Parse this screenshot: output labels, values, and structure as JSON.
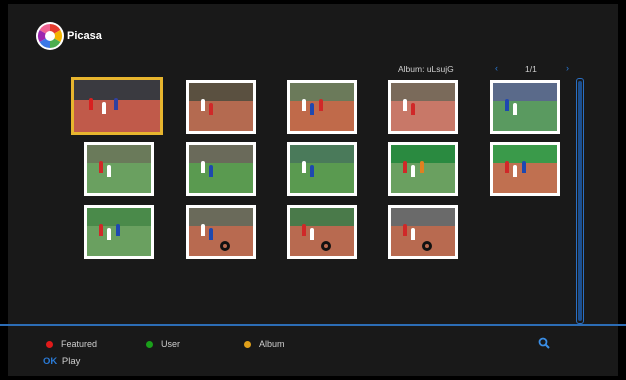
{
  "app": {
    "name": "Picasa"
  },
  "header": {
    "album_title": "Album: uLsujG",
    "page_indicator": "1/1",
    "prev_arrow": "‹",
    "next_arrow": "›"
  },
  "grid": {
    "selected_index": 0,
    "thumbnails": [
      {
        "stand": "#3a3a40",
        "field": "#c05a4a",
        "people": [
          "#d82020",
          "#ffffff",
          "#3040a0"
        ]
      },
      {
        "stand": "#5a5040",
        "field": "#b46a50",
        "people": [
          "#ffffff",
          "#d02828"
        ]
      },
      {
        "stand": "#6b7a5a",
        "field": "#c06a4a",
        "people": [
          "#ffffff",
          "#1e48b0",
          "#d02828"
        ]
      },
      {
        "stand": "#7a6a5a",
        "field": "#c87868",
        "people": [
          "#ffffff",
          "#d02828"
        ]
      },
      {
        "stand": "#5a6a8a",
        "field": "#5a9a60",
        "people": [
          "#1e48b0",
          "#ffffff"
        ]
      },
      {
        "stand": "#6a7a5a",
        "field": "#6aa060",
        "people": [
          "#d02828",
          "#ffffff"
        ]
      },
      {
        "stand": "#6a6a5a",
        "field": "#5a9a50",
        "people": [
          "#ffffff",
          "#1e48b0"
        ]
      },
      {
        "stand": "#4a7a5a",
        "field": "#5a9a50",
        "people": [
          "#ffffff",
          "#1e48b0"
        ]
      },
      {
        "stand": "#2a8a40",
        "field": "#6aa060",
        "people": [
          "#d02828",
          "#ffffff",
          "#e08020"
        ]
      },
      {
        "stand": "#3a9a4a",
        "field": "#c07050",
        "people": [
          "#d02828",
          "#ffffff",
          "#1e48b0"
        ]
      },
      {
        "stand": "#4a8a4a",
        "field": "#6aa060",
        "people": [
          "#d02828",
          "#ffffff",
          "#1e48b0"
        ]
      },
      {
        "stand": "#6a6a5a",
        "field": "#b86a50",
        "people": [
          "#ffffff",
          "#1e48b0"
        ],
        "tire": true
      },
      {
        "stand": "#4a7a4a",
        "field": "#b86a50",
        "people": [
          "#d02828",
          "#ffffff"
        ],
        "tire": true
      },
      {
        "stand": "#6a6a6a",
        "field": "#b86a50",
        "people": [
          "#d02828",
          "#ffffff"
        ],
        "tire": true
      }
    ]
  },
  "footer": {
    "legend": [
      {
        "label": "Featured",
        "color": "#e01a1a"
      },
      {
        "label": "User",
        "color": "#1aa01a"
      },
      {
        "label": "Album",
        "color": "#e0a01a"
      }
    ],
    "ok_key": "OK",
    "ok_action": "Play",
    "search_icon": "search-icon"
  }
}
